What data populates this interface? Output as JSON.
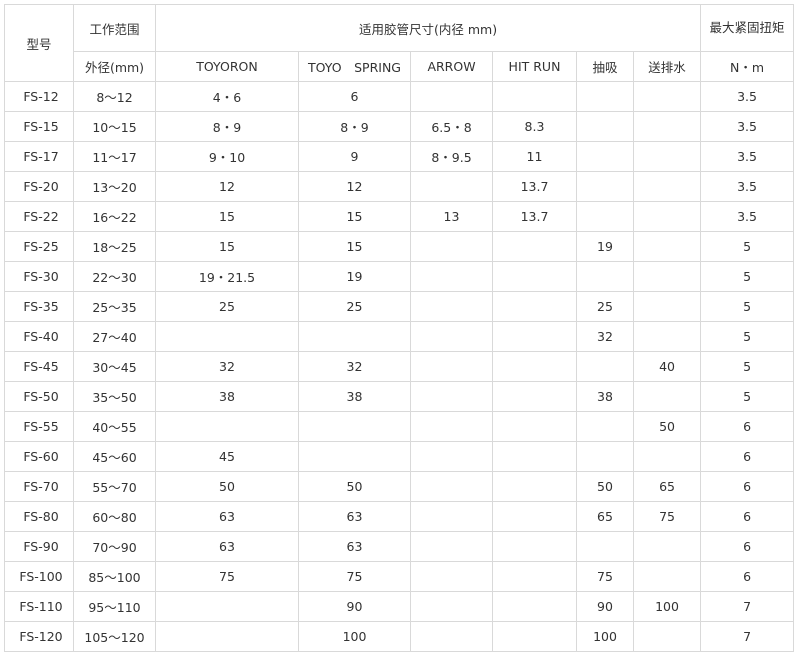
{
  "header": {
    "model": "型号",
    "range": "工作范围",
    "hose_size": "适用胶管尺寸(内径 mm)",
    "torque": "最大紧固扭矩",
    "od": "外径(mm)",
    "brands": [
      "TOYORON",
      "TOYO　SPRING",
      "ARROW",
      "HIT RUN",
      "抽吸",
      "送排水"
    ],
    "torque_unit": "N・m"
  },
  "rows": [
    {
      "model": "FS-12",
      "range": "8～12",
      "toyoron": "4・6",
      "toyo_spring": "6",
      "arrow": "",
      "hit_run": "",
      "suction": "",
      "drainage": "",
      "torque": "3.5"
    },
    {
      "model": "FS-15",
      "range": "10～15",
      "toyoron": "8・9",
      "toyo_spring": "8・9",
      "arrow": "6.5・8",
      "hit_run": "8.3",
      "suction": "",
      "drainage": "",
      "torque": "3.5"
    },
    {
      "model": "FS-17",
      "range": "11～17",
      "toyoron": "9・10",
      "toyo_spring": "9",
      "arrow": "8・9.5",
      "hit_run": "11",
      "suction": "",
      "drainage": "",
      "torque": "3.5"
    },
    {
      "model": "FS-20",
      "range": "13～20",
      "toyoron": "12",
      "toyo_spring": "12",
      "arrow": "",
      "hit_run": "13.7",
      "suction": "",
      "drainage": "",
      "torque": "3.5"
    },
    {
      "model": "FS-22",
      "range": "16～22",
      "toyoron": "15",
      "toyo_spring": "15",
      "arrow": "13",
      "hit_run": "13.7",
      "suction": "",
      "drainage": "",
      "torque": "3.5"
    },
    {
      "model": "FS-25",
      "range": "18～25",
      "toyoron": "15",
      "toyo_spring": "15",
      "arrow": "",
      "hit_run": "",
      "suction": "19",
      "drainage": "",
      "torque": "5"
    },
    {
      "model": "FS-30",
      "range": "22～30",
      "toyoron": "19・21.5",
      "toyo_spring": "19",
      "arrow": "",
      "hit_run": "",
      "suction": "",
      "drainage": "",
      "torque": "5"
    },
    {
      "model": "FS-35",
      "range": "25～35",
      "toyoron": "25",
      "toyo_spring": "25",
      "arrow": "",
      "hit_run": "",
      "suction": "25",
      "drainage": "",
      "torque": "5"
    },
    {
      "model": "FS-40",
      "range": "27～40",
      "toyoron": "",
      "toyo_spring": "",
      "arrow": "",
      "hit_run": "",
      "suction": "32",
      "drainage": "",
      "torque": "5"
    },
    {
      "model": "FS-45",
      "range": "30～45",
      "toyoron": "32",
      "toyo_spring": "32",
      "arrow": "",
      "hit_run": "",
      "suction": "",
      "drainage": "40",
      "torque": "5"
    },
    {
      "model": "FS-50",
      "range": "35～50",
      "toyoron": "38",
      "toyo_spring": "38",
      "arrow": "",
      "hit_run": "",
      "suction": "38",
      "drainage": "",
      "torque": "5"
    },
    {
      "model": "FS-55",
      "range": "40～55",
      "toyoron": "",
      "toyo_spring": "",
      "arrow": "",
      "hit_run": "",
      "suction": "",
      "drainage": "50",
      "torque": "6"
    },
    {
      "model": "FS-60",
      "range": "45～60",
      "toyoron": "45",
      "toyo_spring": "",
      "arrow": "",
      "hit_run": "",
      "suction": "",
      "drainage": "",
      "torque": "6"
    },
    {
      "model": "FS-70",
      "range": "55～70",
      "toyoron": "50",
      "toyo_spring": "50",
      "arrow": "",
      "hit_run": "",
      "suction": "50",
      "drainage": "65",
      "torque": "6"
    },
    {
      "model": "FS-80",
      "range": "60～80",
      "toyoron": "63",
      "toyo_spring": "63",
      "arrow": "",
      "hit_run": "",
      "suction": "65",
      "drainage": "75",
      "torque": "6"
    },
    {
      "model": "FS-90",
      "range": "70～90",
      "toyoron": "63",
      "toyo_spring": "63",
      "arrow": "",
      "hit_run": "",
      "suction": "",
      "drainage": "",
      "torque": "6"
    },
    {
      "model": "FS-100",
      "range": "85～100",
      "toyoron": "75",
      "toyo_spring": "75",
      "arrow": "",
      "hit_run": "",
      "suction": "75",
      "drainage": "",
      "torque": "6"
    },
    {
      "model": "FS-110",
      "range": "95～110",
      "toyoron": "",
      "toyo_spring": "90",
      "arrow": "",
      "hit_run": "",
      "suction": "90",
      "drainage": "100",
      "torque": "7"
    },
    {
      "model": "FS-120",
      "range": "105～120",
      "toyoron": "",
      "toyo_spring": "100",
      "arrow": "",
      "hit_run": "",
      "suction": "100",
      "drainage": "",
      "torque": "7"
    }
  ]
}
